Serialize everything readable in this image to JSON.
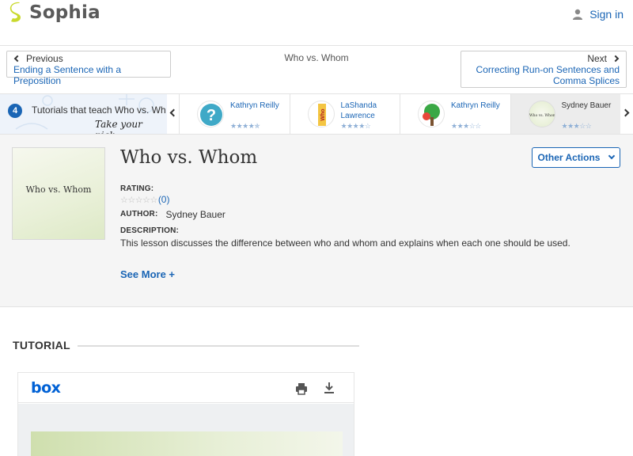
{
  "header": {
    "logo_text": "Sophia",
    "signin_label": "Sign in"
  },
  "nav": {
    "previous_label": "Previous",
    "previous_link": "Ending a Sentence with a Preposition",
    "current_title": "Who vs. Whom",
    "next_label": "Next",
    "next_link_line1": "Correcting Run-on Sentences and",
    "next_link_line2": "Comma Splices"
  },
  "strip": {
    "count": "4",
    "intro_text": "Tutorials that teach Who vs. Wh",
    "pick_text": "Take your pick:",
    "cards": [
      {
        "author": "Kathryn Reilly",
        "stars": "★★★★✯",
        "thumb": "question-mark"
      },
      {
        "author": "LaShanda Lawrence",
        "stars": "★★★★☆",
        "thumb": "who-whom-vertical"
      },
      {
        "author": "Kathryn Reilly",
        "stars": "★★★☆☆",
        "thumb": "tree"
      },
      {
        "author": "Sydney Bauer",
        "stars": "★★★☆☆",
        "thumb": "who-vs-whom"
      }
    ]
  },
  "lesson": {
    "thumb_text": "Who vs. Whom",
    "title": "Who vs. Whom",
    "rating_label": "RATING:",
    "rating_stars": "☆☆☆☆☆",
    "rating_count": "(0)",
    "author_label": "AUTHOR:",
    "author_name": "Sydney Bauer",
    "description_label": "DESCRIPTION:",
    "description": "This lesson discusses the difference between who and whom and explains when each one should be used.",
    "see_more": "See More +",
    "other_actions": "Other Actions"
  },
  "tutorial": {
    "heading": "TUTORIAL",
    "viewer_brand": "box"
  },
  "colors": {
    "brand_green": "#c9d92c",
    "link_blue": "#1a65b5",
    "box_blue": "#0061d5"
  }
}
